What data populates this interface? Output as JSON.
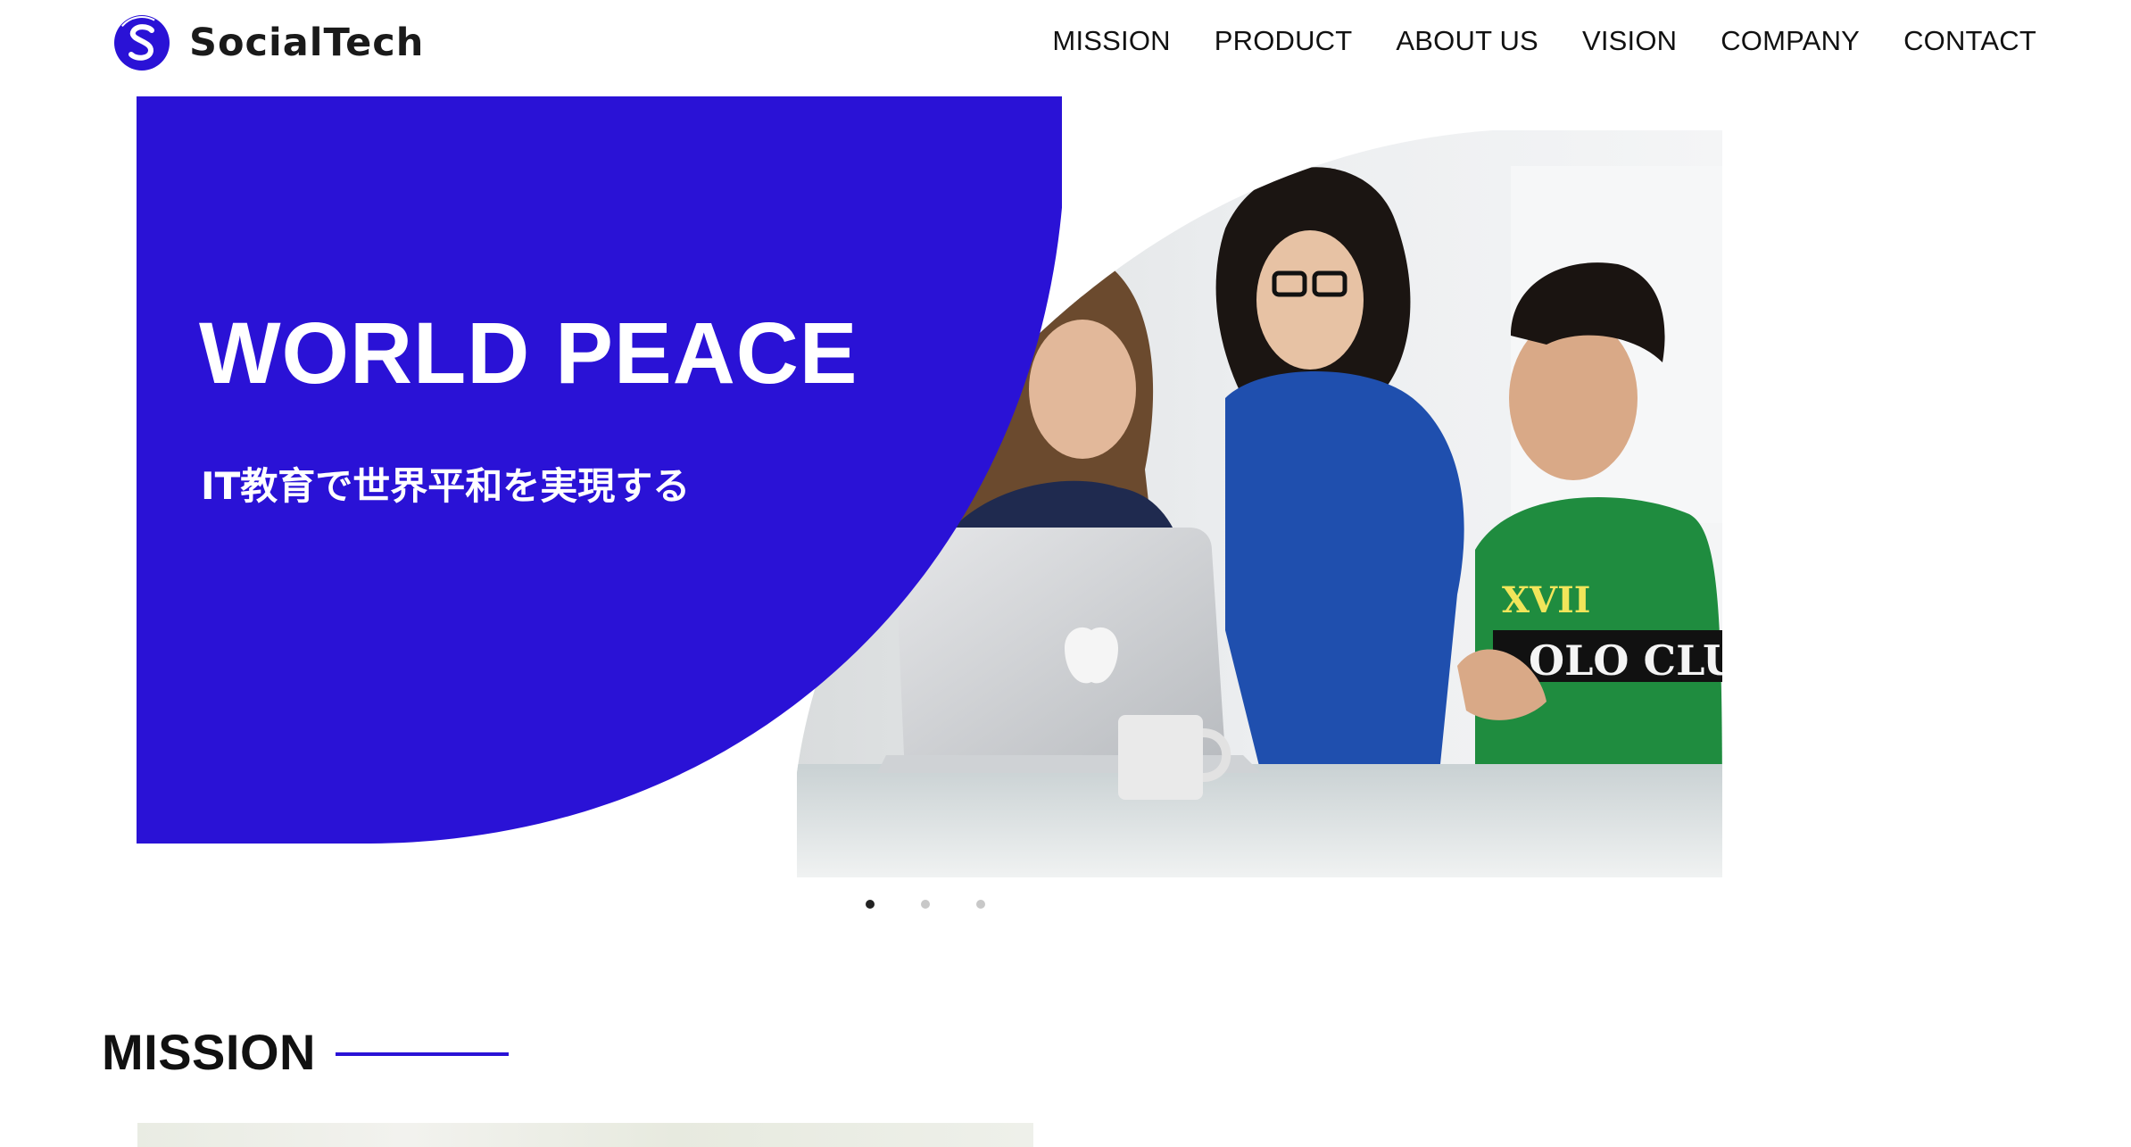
{
  "brand": {
    "name": "SocialTech",
    "logo_letter": "S",
    "accent_color": "#2a12d6"
  },
  "nav": {
    "items": [
      {
        "label": "MISSION"
      },
      {
        "label": "PRODUCT"
      },
      {
        "label": "ABOUT US"
      },
      {
        "label": "VISION"
      },
      {
        "label": "COMPANY"
      },
      {
        "label": "CONTACT"
      }
    ]
  },
  "hero": {
    "title": "WORLD PEACE",
    "subtitle": "IT教育で世界平和を実現する",
    "panel_color": "#2a12d6",
    "slides_total": 3,
    "active_slide": 1
  },
  "mission": {
    "heading": "MISSION"
  }
}
